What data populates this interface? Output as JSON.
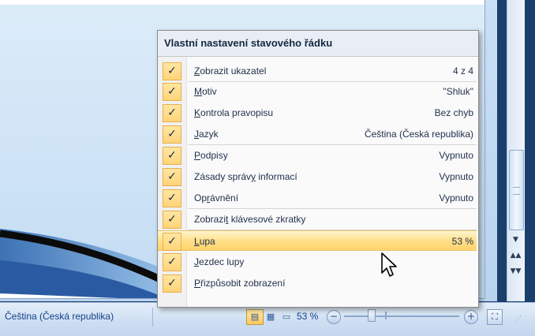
{
  "menu": {
    "title": "Vlastní nastavení stavového řádku",
    "items": [
      {
        "pre": "",
        "u": "Z",
        "post": "obrazit ukazatel",
        "value": "4 z 4",
        "checked": true
      },
      {
        "pre": "",
        "u": "M",
        "post": "otiv",
        "value": "\"Shluk\"",
        "checked": true
      },
      {
        "pre": "",
        "u": "K",
        "post": "ontrola pravopisu",
        "value": "Bez chyb",
        "checked": true
      },
      {
        "pre": "",
        "u": "J",
        "post": "azyk",
        "value": "Čeština (Česká republika)",
        "checked": true
      },
      {
        "pre": "",
        "u": "P",
        "post": "odpisy",
        "value": "Vypnuto",
        "checked": true
      },
      {
        "pre": "Zásady správ",
        "u": "y",
        "post": " informací",
        "value": "Vypnuto",
        "checked": true
      },
      {
        "pre": "Op",
        "u": "r",
        "post": "ávnění",
        "value": "Vypnuto",
        "checked": true
      },
      {
        "pre": "Zobrazi",
        "u": "t",
        "post": " klávesové zkratky",
        "value": "",
        "checked": true
      },
      {
        "pre": "",
        "u": "L",
        "post": "upa",
        "value": "53 %",
        "checked": true,
        "highlighted": true
      },
      {
        "pre": "",
        "u": "J",
        "post": "ezdec lupy",
        "value": "",
        "checked": true
      },
      {
        "pre": "",
        "u": "P",
        "post": "řizpůsobit zobrazení",
        "value": "",
        "checked": true
      }
    ],
    "check_glyph": "✓"
  },
  "statusbar": {
    "language": "Čeština (Česká republika)",
    "zoom": "53 %",
    "zoom_level": 0.53,
    "view_icons": [
      "normal-view-icon",
      "slide-sorter-icon",
      "slide-show-icon"
    ],
    "zoom_out": "−",
    "zoom_in": "+"
  },
  "colors": {
    "accent": "#ffd479",
    "highlight": "#ffe08a",
    "statusbar": "#cfdff2",
    "text": "#15428b"
  }
}
